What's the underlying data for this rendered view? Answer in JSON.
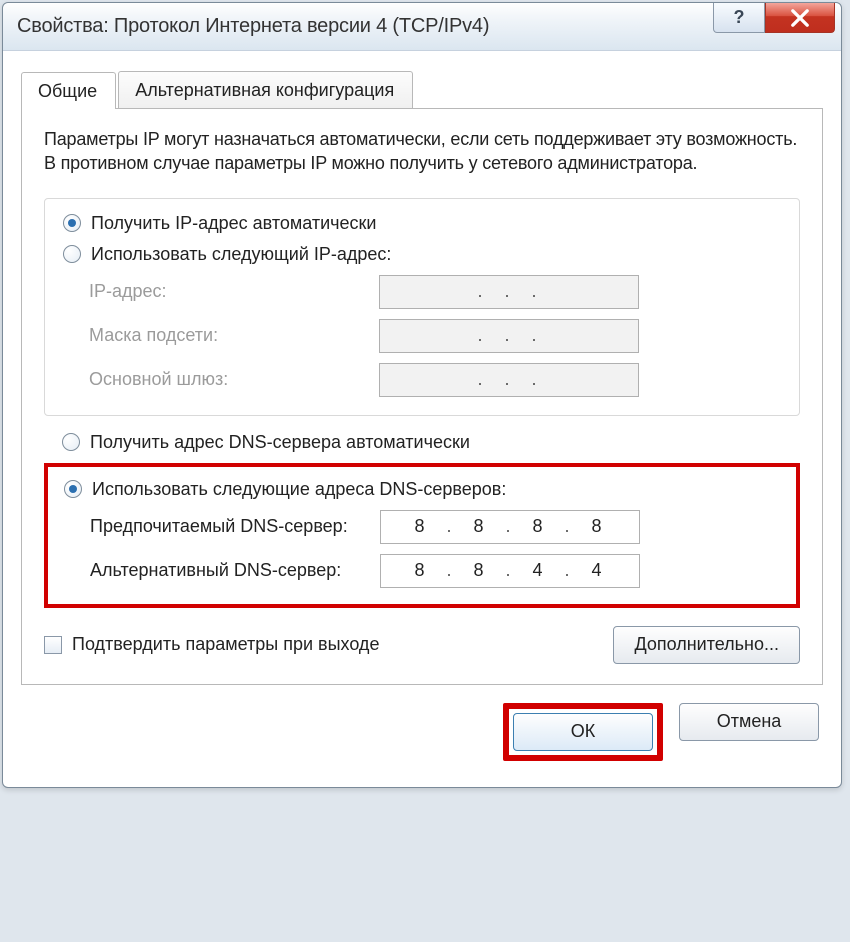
{
  "titlebar": {
    "title": "Свойства: Протокол Интернета версии 4 (TCP/IPv4)"
  },
  "tabs": {
    "general": "Общие",
    "alt": "Альтернативная конфигурация"
  },
  "intro": "Параметры IP могут назначаться автоматически, если сеть поддерживает эту возможность. В противном случае параметры IP можно получить у сетевого администратора.",
  "ip": {
    "auto_label": "Получить IP-адрес автоматически",
    "manual_label": "Использовать следующий IP-адрес:",
    "address_label": "IP-адрес:",
    "mask_label": "Маска подсети:",
    "gateway_label": "Основной шлюз:"
  },
  "dns": {
    "auto_label": "Получить адрес DNS-сервера автоматически",
    "manual_label": "Использовать следующие адреса DNS-серверов:",
    "preferred_label": "Предпочитаемый DNS-сервер:",
    "alternate_label": "Альтернативный DNS-сервер:",
    "preferred_value": {
      "a": "8",
      "b": "8",
      "c": "8",
      "d": "8"
    },
    "alternate_value": {
      "a": "8",
      "b": "8",
      "c": "4",
      "d": "4"
    }
  },
  "validate_label": "Подтвердить параметры при выходе",
  "advanced_label": "Дополнительно...",
  "ok_label": "ОК",
  "cancel_label": "Отмена"
}
